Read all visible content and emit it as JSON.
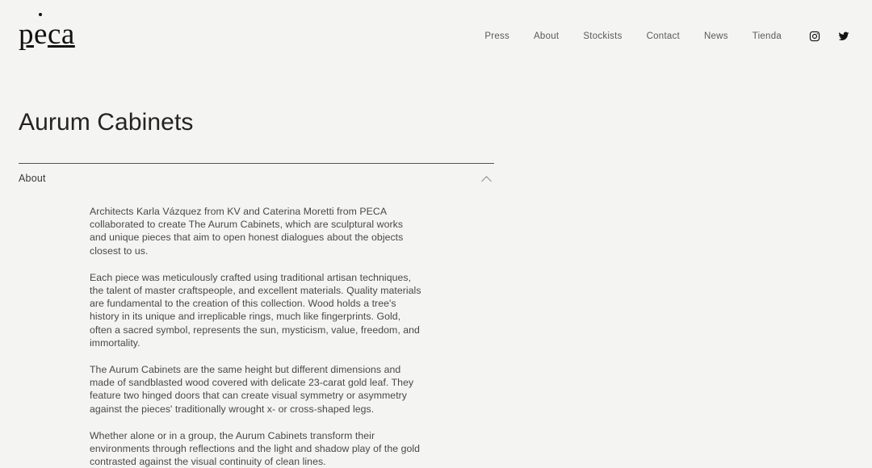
{
  "header": {
    "logo": {
      "text_before": "p",
      "text_accented": "e",
      "text_after": "ca",
      "full": "peca"
    },
    "nav_items": [
      {
        "label": "Press"
      },
      {
        "label": "About"
      },
      {
        "label": "Stockists"
      },
      {
        "label": "Contact"
      },
      {
        "label": "News"
      },
      {
        "label": "Tienda"
      }
    ],
    "social": [
      {
        "name": "instagram-icon",
        "label": "Instagram"
      },
      {
        "name": "twitter-icon",
        "label": "Twitter"
      }
    ]
  },
  "main": {
    "page_title": "Aurum Cabinets",
    "accordion": {
      "label": "About",
      "expanded": true,
      "toggle_icon": "chevron-up-icon",
      "paragraphs": [
        "Architects Karla Vázquez from KV and Caterina Moretti from PECA collaborated to create The Aurum Cabinets, which are sculptural works and unique pieces that aim to open honest dialogues about the objects closest to us.",
        "Each piece was meticulously crafted using traditional artisan techniques, the talent of master craftspeople, and excellent materials. Quality materials are fundamental to the creation of this collection. Wood holds a tree's history in its unique and irreplicable rings, much like fingerprints. Gold, often a sacred symbol, represents the sun, mysticism, value, freedom, and immortality.",
        "The Aurum Cabinets are the same height but different dimensions and made of sandblasted wood covered with delicate 23-carat gold leaf. They feature two hinged doors that can create visual symmetry or asymmetry against the pieces' traditionally wrought x- or cross-shaped legs.",
        "Whether alone or in a group, the Aurum Cabinets transform their environments through reflections and the light and shadow play of the gold contrasted against the visual continuity of clean lines."
      ]
    }
  },
  "colors": {
    "background": "#f4f4f2",
    "text_primary": "#25231f",
    "text_body": "#4a4843",
    "text_nav": "#5a5a5a",
    "rule": "#54524e"
  }
}
